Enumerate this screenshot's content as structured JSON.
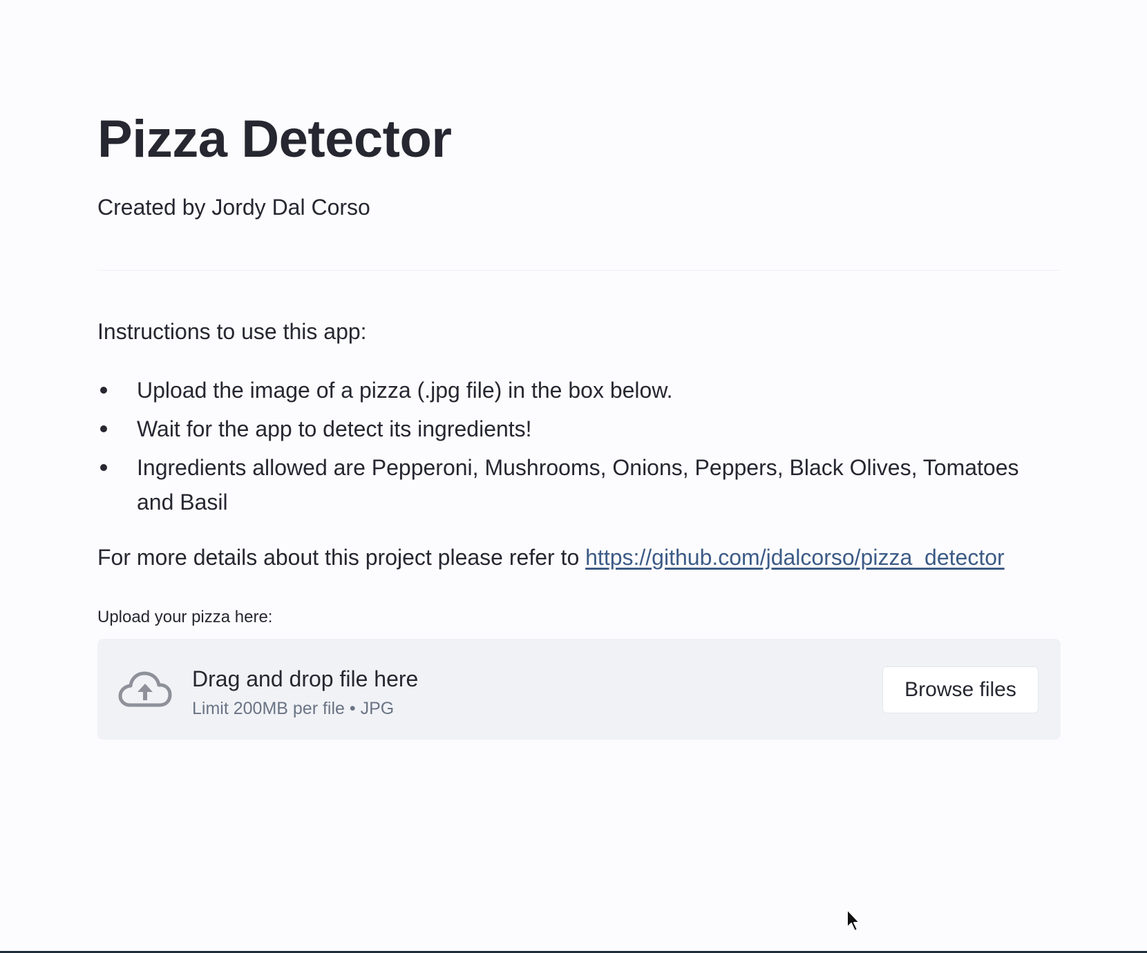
{
  "page": {
    "title": "Pizza Detector",
    "author": "Created by Jordy Dal Corso"
  },
  "instructions": {
    "heading": "Instructions to use this app:",
    "items": [
      "Upload the image of a pizza (.jpg file) in the box below.",
      "Wait for the app to detect its ingredients!",
      "Ingredients allowed are Pepperoni, Mushrooms, Onions, Peppers, Black Olives, Tomatoes and Basil"
    ]
  },
  "details": {
    "text": "For more details about this project please refer to ",
    "link_text": "https://github.com/jdalcorso/pizza_detector"
  },
  "uploader": {
    "label": "Upload your pizza here:",
    "drop_title": "Drag and drop file here",
    "limit_text": "Limit 200MB per file • JPG",
    "browse_label": "Browse files",
    "icon": "cloud-upload-icon"
  },
  "colors": {
    "background": "#fcfcfe",
    "text": "#262730",
    "link": "#3c5b86",
    "dropzone": "#f0f2f6",
    "muted": "#6b7484"
  }
}
